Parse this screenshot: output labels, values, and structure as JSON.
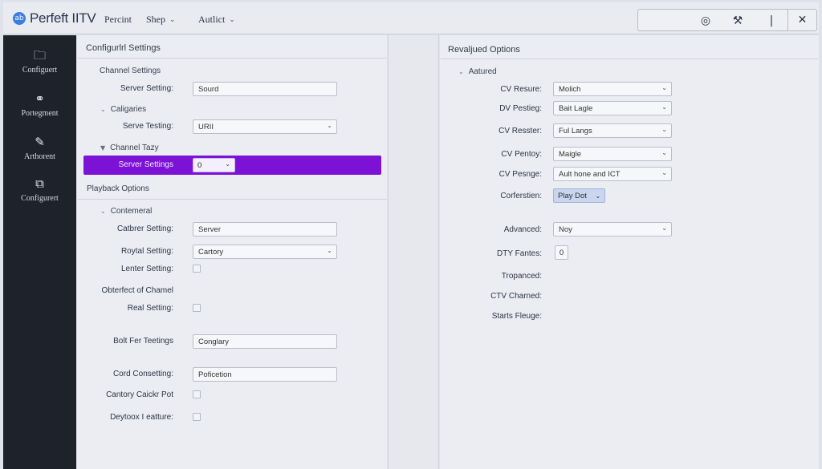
{
  "app": {
    "logo_mark": "ab",
    "title": "Perfeft IITV"
  },
  "menu": [
    {
      "label": "Percint",
      "has_chevron": false
    },
    {
      "label": "Shep",
      "has_chevron": true
    },
    {
      "label": "Autlict",
      "has_chevron": true
    }
  ],
  "window_buttons": {
    "icons": [
      "target-icon",
      "tools-icon",
      "info-icon",
      "close-icon"
    ],
    "glyphs": [
      "◎",
      "⚒",
      "|",
      "✕"
    ]
  },
  "sidebar": {
    "items": [
      {
        "label": "Configuert",
        "icon": "folder-icon",
        "glyph": "🗀"
      },
      {
        "label": "Portegment",
        "icon": "link-icon",
        "glyph": "⚭"
      },
      {
        "label": "Arthorent",
        "icon": "brush-icon",
        "glyph": "✎"
      },
      {
        "label": "Configurert",
        "icon": "settings-card-icon",
        "glyph": "⧉"
      }
    ]
  },
  "left_panel": {
    "title": "Configurlrl Settings",
    "channel_settings": {
      "header": "Channel Settings",
      "server_setting_label": "Server Setting:",
      "server_setting_value": "Sourd",
      "categories_header": "Caligaries",
      "serve_testing_label": "Serve Testing:",
      "serve_testing_value": "URII",
      "channel_tazy_header": "Channel Tazy",
      "server_settings_label": "Server Settings",
      "server_settings_value": "0"
    },
    "playback": {
      "title": "Playback Options",
      "group_header": "Contemeral",
      "catbrer_label": "Catbrer Setting:",
      "catbrer_value": "Server",
      "roytal_label": "Roytal Setting:",
      "roytal_value": "Cartory",
      "lenter_label": "Lenter Setting:",
      "obterfect_label": "Obterfect of Chamel",
      "real_label": "Real Setting:",
      "bolt_label": "Bolt Fer Teetings",
      "bolt_value": "Conglary",
      "cord_label": "Cord Consetting:",
      "cord_value": "Poficetion",
      "cantory_label": "Cantory Caickr Pot",
      "deytoox_label": "Deytoox I eatture:"
    }
  },
  "right_panel": {
    "title": "Revaljued Options",
    "group_header": "Aatured",
    "rows": [
      {
        "label": "CV Resure:",
        "value": "Molich"
      },
      {
        "label": "DV Pestieg:",
        "value": "Bait Lagle"
      },
      {
        "label": "CV Resster:",
        "value": "Ful Langs"
      },
      {
        "label": "CV Pentoy:",
        "value": "Maigle"
      },
      {
        "label": "CV Pesnge:",
        "value": "Ault hone and ICT"
      }
    ],
    "corferstien_label": "Corferstien:",
    "corferstien_value": "Play Dot",
    "advanced_label": "Advanced:",
    "advanced_value": "Noy",
    "dty_label": "DTY Fantes:",
    "dty_value": "0",
    "tropanced_label": "Tropanced:",
    "ctv_label": "CTV Charned:",
    "starts_label": "Starts Fleuge:"
  }
}
